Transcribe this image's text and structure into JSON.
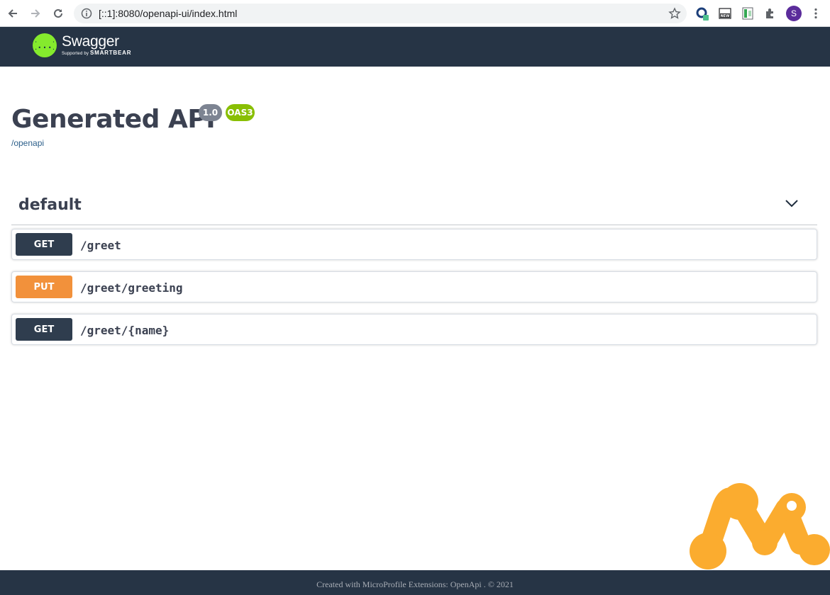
{
  "browser": {
    "url": "[::1]:8080/openapi-ui/index.html",
    "icons": {
      "back": "arrow-left-icon",
      "forward": "arrow-right-icon",
      "reload": "reload-icon",
      "info": "info-icon",
      "bookmark": "star-icon",
      "menu": "more-vert-icon"
    },
    "extensions": [
      "extension-icon",
      "extension-new-icon",
      "extension-sheet-icon",
      "puzzle-icon"
    ],
    "avatar_letter": "S",
    "avatar_color": "#5b2c9b"
  },
  "header": {
    "logo_title": "Swagger",
    "logo_sub_prefix": "Supported by",
    "logo_sub_brand": "SMARTBEAR",
    "logo_glyph": "{...}",
    "brand_color": "#85ea2d",
    "bg_color": "#263445"
  },
  "info": {
    "title": "Generated API",
    "version": "1.0",
    "oas_badge": "OAS3",
    "spec_link": "/openapi"
  },
  "tag": {
    "name": "default",
    "toggle_icon": "chevron-down-icon"
  },
  "operations": [
    {
      "method": "GET",
      "path": "/greet",
      "color": "#2f3d4e"
    },
    {
      "method": "PUT",
      "path": "/greet/greeting",
      "color": "#f2913b"
    },
    {
      "method": "GET",
      "path": "/greet/{name}",
      "color": "#2f3d4e"
    }
  ],
  "decor": {
    "logo": "microprofile-logo-icon",
    "color": "#fbac2f"
  },
  "footer": {
    "text": "Created with MicroProfile Extensions: OpenApi . © 2021"
  }
}
